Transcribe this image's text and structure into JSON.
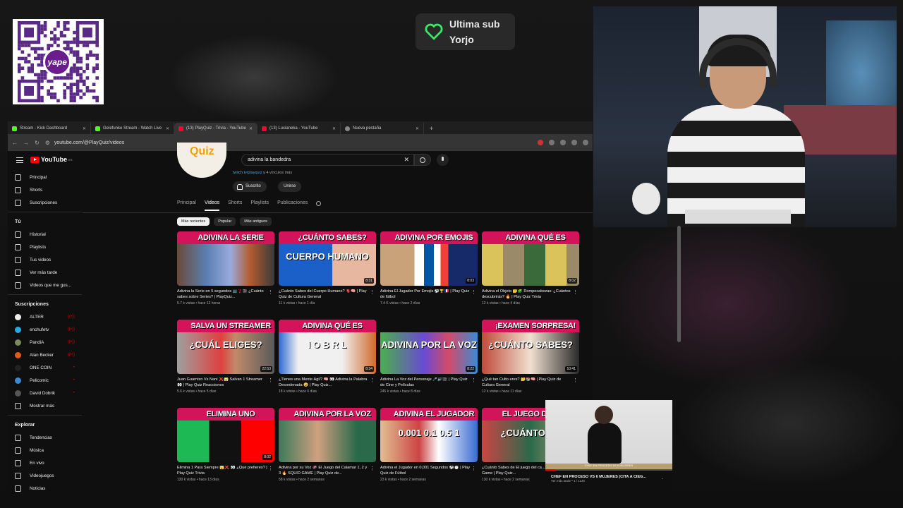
{
  "overlay": {
    "sub_line1": "Ultima sub",
    "sub_line2": "Yorjo",
    "qr_logo": "yape"
  },
  "tabs": [
    {
      "label": "Stream - Kick Dashboard",
      "fav": "k"
    },
    {
      "label": "Gelefunke Stream - Watch Live",
      "fav": "k"
    },
    {
      "label": "(13) PlayQuiz - Trivia - YouTube",
      "fav": "y"
    },
    {
      "label": "(13) Lucianeka - YouTube",
      "fav": "y"
    },
    {
      "label": "Nueva pestaña",
      "fav": "g"
    }
  ],
  "address": {
    "url": "youtube.com/@PlayQuiz/videos"
  },
  "youtube": {
    "logo": "YouTube",
    "region": "ES",
    "search_value": "adivina la bandedra"
  },
  "sidebar": {
    "main": [
      "Principal",
      "Shorts",
      "Suscripciones"
    ],
    "you_header": "Tú",
    "you": [
      "Historial",
      "Playlists",
      "Tus videos",
      "Ver más tarde",
      "Videos que me gus..."
    ],
    "subs_header": "Suscripciones",
    "subs": [
      {
        "name": "ALTER",
        "color": "#eeeeee",
        "live": "((•))"
      },
      {
        "name": "enchufetv",
        "color": "#2aa8e0",
        "live": "((•))"
      },
      {
        "name": "PandiA",
        "color": "#7a8a5a",
        "live": "((•))"
      },
      {
        "name": "Alan Becker",
        "color": "#e05a1a",
        "live": "((•))"
      },
      {
        "name": "ONE COIN",
        "color": "#222222",
        "live": "•"
      },
      {
        "name": "Pelicomic",
        "color": "#3a8ad4",
        "live": "•"
      },
      {
        "name": "David Dobrik",
        "color": "#555555",
        "live": "•"
      }
    ],
    "show_more": "Mostrar más",
    "explore_header": "Explorar",
    "explore": [
      "Tendencias",
      "Música",
      "En vivo",
      "Videojuegos",
      "Noticias"
    ]
  },
  "channel": {
    "logo_text": "Quiz",
    "links": "twitch.tv/playquiz",
    "links_more": " y 4 vínculos más",
    "subscribed": "Suscrito",
    "join": "Unirse"
  },
  "channel_tabs": [
    "Principal",
    "Videos",
    "Shorts",
    "Playlists",
    "Publicaciones"
  ],
  "chips": [
    "Más recientes",
    "Popular",
    "Más antiguos"
  ],
  "videos": [
    {
      "banner": "ADIVINA LA SERIE",
      "title": "Adivina la Serie en 5 segundos 📺❓🎬 ¿Cuánto sabes sobre Series? | PlayQuiz...",
      "meta": "5.7 k vistas • hace 12 horas",
      "dur": "",
      "art": "a1",
      "big": ""
    },
    {
      "banner": "¿CUÁNTO SABES?",
      "title": "¿Cuánto Sabes del Cuerpo Humano? 🫀🧠 | Play Quiz de Cultura General",
      "meta": "11 k vistas • hace 1 día",
      "dur": "8:31",
      "art": "a2",
      "big": "CUERPO HUMANO"
    },
    {
      "banner": "ADIVINA POR EMOJIS",
      "title": "Adivina El Jugador Por Emojis ⚽🏆🇫🇷 | Play Quiz de fútbol",
      "meta": "7.4 K vistas • hace 2 días",
      "dur": "8:03",
      "art": "a3",
      "big": ""
    },
    {
      "banner": "ADIVINA QUÉ ES",
      "title": "Adivina el Objeto 🤔🧩 Rompecabezas: ¿Cuántos descubrirás? 🔥 | Play Quiz Trivia",
      "meta": "12 k vistas • hace 4 días",
      "dur": "8:02",
      "art": "a4",
      "big": ""
    },
    {
      "banner": "SALVA UN STREAMER",
      "title": "Juan Guarnizo Vs Nani ❌😱 Salvan 1 Streamer 👀 | Play Quiz Reacciones",
      "meta": "5.6 k vistas • hace 5 días",
      "dur": "22:53",
      "art": "a5",
      "big": "¿CUÁL ELIGES?"
    },
    {
      "banner": "ADIVINA QUÉ ES",
      "title": "¿Tienes una Mente Ágil? 🧠 👀 Adivina la Palabra Desordenada 😉 | Play Quiz...",
      "meta": "18 k vistas • hace 6 días",
      "dur": "8:34",
      "art": "a6",
      "big": "I O B R L"
    },
    {
      "banner": "",
      "title": "Adivina La Voz del Personaje 🎤🔊🎬 | Play Quiz de Cine y Películas",
      "meta": "245 k vistas • hace 8 días",
      "dur": "8:22",
      "art": "a7",
      "big": "ADIVINA POR LA VOZ"
    },
    {
      "banner": "¡EXAMEN SORPRESA!",
      "title": "¿Qué tan Culto eres? 🤔📚🧠 | Play Quiz de Cultura General",
      "meta": "12 k vistas • hace 11 días",
      "dur": "10:41",
      "art": "a8",
      "big": "¿CUÁNTO SABES?"
    },
    {
      "banner": "ELIMINA UNO",
      "title": "Elimina 1 Para Siempre 😱❌ 👀 ¿Qué prefieres? | Play Quiz Trivia",
      "meta": "130 k vistas • hace 13 días",
      "dur": "8:02",
      "art": "a9",
      "big": ""
    },
    {
      "banner": "ADIVINA POR LA VOZ",
      "title": "Adivina por su Voz 🦑 El Juego del Calamar 1, 2 y 3 🔥 SQUID GAME | Play Quiz de...",
      "meta": "58 k vistas • hace 2 semanas",
      "dur": "",
      "art": "a10",
      "big": ""
    },
    {
      "banner": "ADIVINA EL JUGADOR",
      "title": "Adivina el Jugador en 0,001 Segundos ⚽⏱️ | Play Quiz de Fútbol",
      "meta": "23 k vistas • hace 2 semanas",
      "dur": "",
      "art": "a11",
      "big": "0.001  0.1  0.5  1"
    },
    {
      "banner": "EL JUEGO DEL CA",
      "title": "¿Cuánto Sabes de El juego del ca... 🦑🔴 Squid Game | Play Quiz...",
      "meta": "130 k vistas • hace 2 semanas",
      "dur": "",
      "art": "a12",
      "big": "¿CUÁNTO SA"
    }
  ],
  "pip": {
    "caption": "CHEF EN PROCESO VS 6 MUJERES",
    "title": "CHEF EN PROCESO VS 6 MUJERES (CITA A CIEG...",
    "meta": "Ver más tarde • 1 / 1145"
  }
}
